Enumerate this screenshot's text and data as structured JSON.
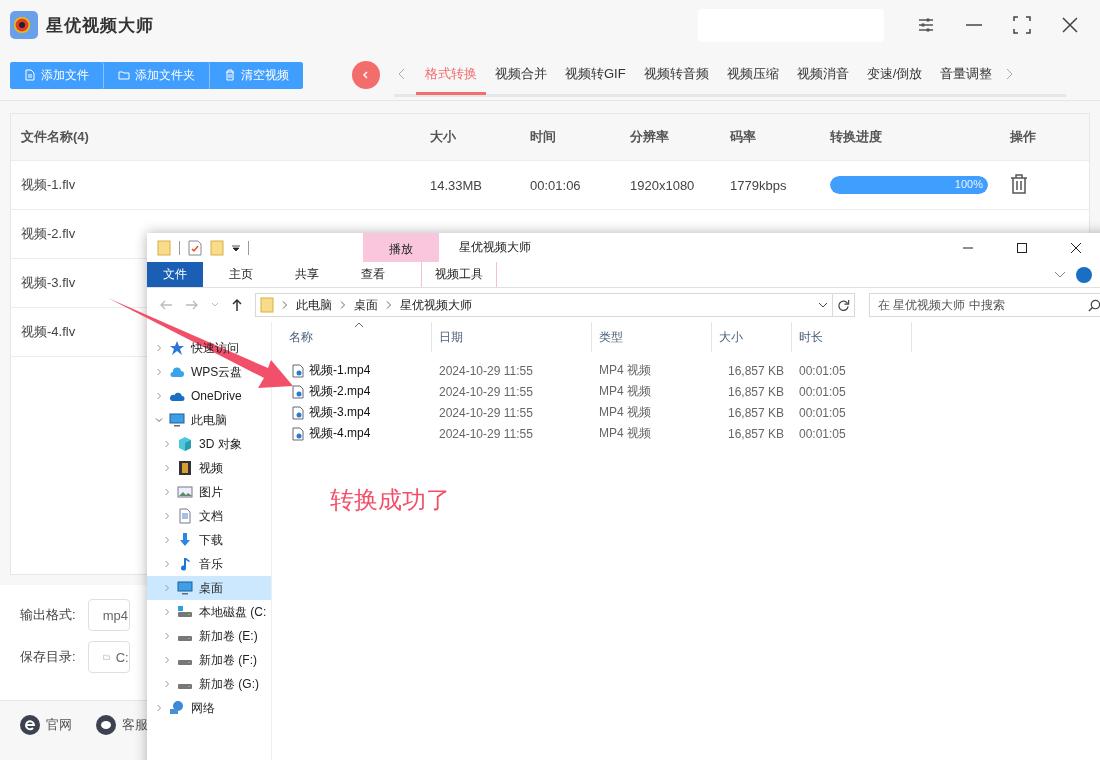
{
  "app": {
    "title": "星优视频大师",
    "toolbar": [
      "添加文件",
      "添加文件夹",
      "清空视频"
    ],
    "tabs": [
      {
        "label": "格式转换",
        "selected": true
      },
      {
        "label": "视频合并",
        "selected": false
      },
      {
        "label": "视频转GIF",
        "selected": false
      },
      {
        "label": "视频转音频",
        "selected": false
      },
      {
        "label": "视频压缩",
        "selected": false
      },
      {
        "label": "视频消音",
        "selected": false
      },
      {
        "label": "变速/倒放",
        "selected": false
      },
      {
        "label": "音量调整",
        "selected": false
      }
    ],
    "table": {
      "columns": [
        "文件名称(4)",
        "大小",
        "时间",
        "分辨率",
        "码率",
        "转换进度",
        "操作"
      ],
      "rows": [
        {
          "name": "视频-1.flv",
          "size": "14.33MB",
          "time": "00:01:06",
          "resolution": "1920x1080",
          "bitrate": "1779kbps",
          "level": 1,
          "progress": "100%"
        },
        {
          "name": "视频-2.flv"
        },
        {
          "name": "视频-3.flv"
        },
        {
          "name": "视频-4.flv"
        }
      ]
    },
    "output": {
      "format_label": "输出格式:",
      "format_value": "mp4",
      "dir_label": "保存目录:",
      "dir_value": "C:"
    },
    "footer": [
      "官网",
      "客服"
    ]
  },
  "explorer": {
    "context_tab": "播放",
    "title": "星优视频大师",
    "ribbon_tabs": [
      {
        "label": "文件",
        "selected": true
      },
      {
        "label": "主页",
        "selected": false
      },
      {
        "label": "共享",
        "selected": false
      },
      {
        "label": "查看",
        "selected": false
      },
      {
        "label": "视频工具",
        "selected": false
      }
    ],
    "path": [
      "此电脑",
      "桌面",
      "星优视频大师"
    ],
    "search": {
      "placeholder": "在 星优视频大师 中搜索"
    },
    "nav": [
      {
        "label": "快速访问",
        "kind": "star",
        "expanded": false,
        "selected": false
      },
      {
        "label": "WPS云盘",
        "kind": "cloud",
        "expanded": false,
        "selected": false
      },
      {
        "label": "OneDrive",
        "kind": "onedrive",
        "expanded": false,
        "selected": false
      },
      {
        "label": "此电脑",
        "kind": "pc",
        "expanded": true,
        "selected": false,
        "children": [
          {
            "label": "3D 对象",
            "kind": "cube",
            "expanded": false,
            "selected": false
          },
          {
            "label": "视频",
            "kind": "film",
            "expanded": false,
            "selected": false
          },
          {
            "label": "图片",
            "kind": "picture",
            "expanded": false,
            "selected": false
          },
          {
            "label": "文档",
            "kind": "doc",
            "expanded": false,
            "selected": false
          },
          {
            "label": "下载",
            "kind": "download",
            "expanded": false,
            "selected": false
          },
          {
            "label": "音乐",
            "kind": "music",
            "expanded": false,
            "selected": false
          },
          {
            "label": "桌面",
            "kind": "desktop",
            "expanded": false,
            "selected": true
          },
          {
            "label": "本地磁盘 (C:",
            "kind": "disk",
            "expanded": false,
            "selected": false
          },
          {
            "label": "新加卷 (E:)",
            "kind": "drive",
            "expanded": false,
            "selected": false
          },
          {
            "label": "新加卷 (F:)",
            "kind": "drive",
            "expanded": false,
            "selected": false
          },
          {
            "label": "新加卷 (G:)",
            "kind": "drive",
            "expanded": false,
            "selected": false
          }
        ]
      },
      {
        "label": "网络",
        "kind": "network",
        "expanded": false,
        "selected": false
      }
    ],
    "columns": [
      "名称",
      "日期",
      "类型",
      "大小",
      "时长"
    ],
    "files": [
      {
        "name": "视频-1.mp4",
        "date": "2024-10-29 11:55",
        "type": "MP4 视频",
        "size": "16,857 KB",
        "duration": "00:01:05"
      },
      {
        "name": "视频-2.mp4",
        "date": "2024-10-29 11:55",
        "type": "MP4 视频",
        "size": "16,857 KB",
        "duration": "00:01:05"
      },
      {
        "name": "视频-3.mp4",
        "date": "2024-10-29 11:55",
        "type": "MP4 视频",
        "size": "16,857 KB",
        "duration": "00:01:05"
      },
      {
        "name": "视频-4.mp4",
        "date": "2024-10-29 11:55",
        "type": "MP4 视频",
        "size": "16,857 KB",
        "duration": "00:01:05"
      }
    ]
  },
  "annotation": {
    "text": "转换成功了"
  }
}
